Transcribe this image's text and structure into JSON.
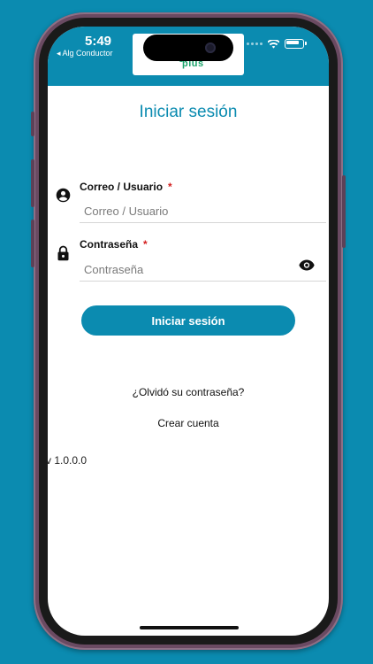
{
  "status_bar": {
    "time": "5:49",
    "back_app": "◂ Alg Conductor"
  },
  "header": {
    "logo_text": "plus"
  },
  "login": {
    "title": "Iniciar sesión",
    "user_field": {
      "label": "Correo / Usuario",
      "required_mark": "*",
      "placeholder": "Correo / Usuario"
    },
    "password_field": {
      "label": "Contraseña",
      "required_mark": "*",
      "placeholder": "Contraseña"
    },
    "submit_label": "Iniciar sesión",
    "forgot_password": "¿Olvidó su contraseña?",
    "create_account": "Crear cuenta",
    "version": "v 1.0.0.0"
  },
  "colors": {
    "brand": "#0b8bb0",
    "required": "#d42020",
    "logo": "#1aa36a"
  },
  "icons": {
    "user": "account-circle-icon",
    "password": "lock-icon",
    "show_password": "eye-icon",
    "wifi": "wifi-icon",
    "battery": "battery-icon"
  }
}
